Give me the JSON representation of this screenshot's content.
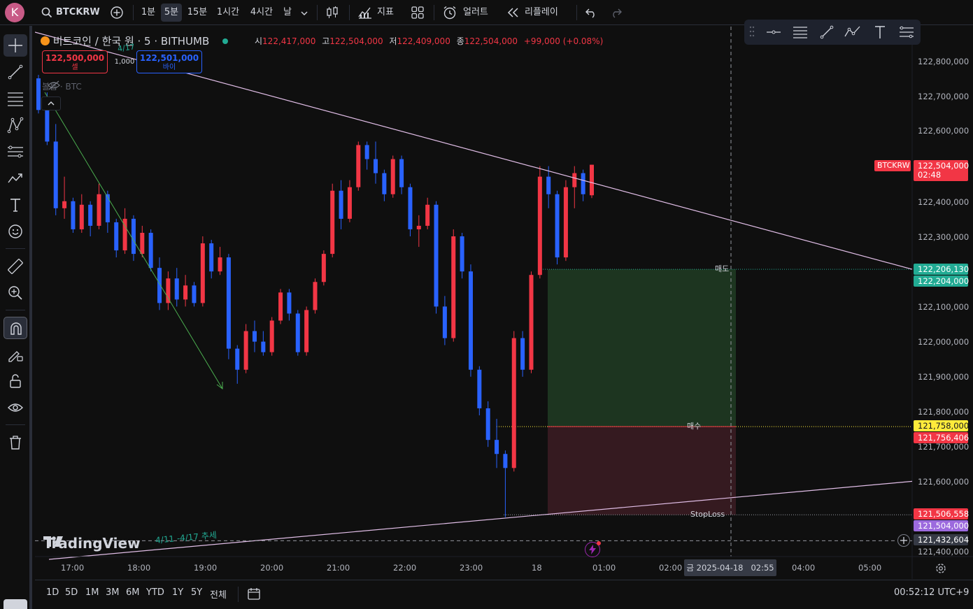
{
  "header": {
    "avatar_letter": "K",
    "symbol": "BTCKRW",
    "intervals": [
      "1분",
      "5분",
      "15분",
      "1시간",
      "4시간",
      "날"
    ],
    "active_interval": "5분",
    "indicators_label": "지표",
    "alert_label": "얼러트",
    "replay_label": "리플레이"
  },
  "legend": {
    "title": "비트코인 / 한국 원 · 5 · BITHUMB",
    "o_label": "시",
    "o_value": "122,417,000",
    "h_label": "고",
    "h_value": "122,504,000",
    "l_label": "저",
    "l_value": "122,409,000",
    "c_label": "종",
    "c_value": "122,504,000",
    "change": "+99,000 (+0.08%)",
    "sell_price": "122,500,000",
    "sell_label": "셀",
    "qty": "1,000",
    "buy_price": "122,501,000",
    "buy_label": "바이",
    "volume_label": "볼륨 · BTC"
  },
  "price_axis": {
    "ticks": [
      "122,800,000",
      "122,700,000",
      "122,600,000",
      "122,400,000",
      "122,300,000",
      "122,100,000",
      "122,000,000",
      "121,900,000",
      "121,800,000",
      "121,700,000",
      "121,600,000",
      "121,400,000"
    ],
    "tags": {
      "symbol": "BTCKRW",
      "last_price": "122,504,000",
      "countdown": "02:48",
      "trend_upper": "122,206,130",
      "target": "122,204,000",
      "entry": "121,758,000",
      "entry_alt": "121,756,406",
      "stop": "121,506,558",
      "trend_lower": "121,504,000",
      "crosshair": "121,432,604"
    }
  },
  "time_axis": {
    "ticks": [
      "17:00",
      "18:00",
      "19:00",
      "20:00",
      "21:00",
      "22:00",
      "23:00",
      "18",
      "01:00",
      "02:00",
      "04:00",
      "05:00"
    ],
    "crosshair_label": "금 2025-04-18   02:55"
  },
  "annotations": {
    "sell_label": "매도",
    "buy_label": "매수",
    "stop_label": "StopLoss",
    "trend_text": "4/11 -4/17 추세",
    "top_trend_text": "4/17",
    "watermark": "TradingView"
  },
  "bottom": {
    "ranges": [
      "1D",
      "5D",
      "1M",
      "3M",
      "6M",
      "YTD",
      "1Y",
      "5Y",
      "전체"
    ],
    "clock": "00:52:12 UTC+9"
  },
  "colors": {
    "up": "#f23645",
    "down": "#2962ff",
    "profit_zone": "#1f3a22",
    "loss_zone": "#3a1c22",
    "target_green": "#22ab94",
    "entry_yellow": "#ffeb3b",
    "trend_line": "#e1bee7",
    "arrow_green": "#4caf50"
  },
  "chart_data": {
    "type": "candlestick",
    "ylim": [
      121350000,
      122850000
    ],
    "candles": [
      [
        122750000,
        122760000,
        122650000,
        122660000
      ],
      [
        122660000,
        122710000,
        122560000,
        122570000
      ],
      [
        122570000,
        122620000,
        122360000,
        122380000
      ],
      [
        122380000,
        122470000,
        122350000,
        122400000
      ],
      [
        122400000,
        122410000,
        122310000,
        122320000
      ],
      [
        122320000,
        122420000,
        122310000,
        122390000
      ],
      [
        122390000,
        122400000,
        122300000,
        122330000
      ],
      [
        122330000,
        122450000,
        122320000,
        122420000
      ],
      [
        122420000,
        122430000,
        122310000,
        122340000
      ],
      [
        122340000,
        122350000,
        122240000,
        122260000
      ],
      [
        122260000,
        122380000,
        122250000,
        122350000
      ],
      [
        122350000,
        122360000,
        122230000,
        122250000
      ],
      [
        122250000,
        122330000,
        122240000,
        122310000
      ],
      [
        122310000,
        122320000,
        122200000,
        122210000
      ],
      [
        122210000,
        122240000,
        122090000,
        122110000
      ],
      [
        122110000,
        122200000,
        122090000,
        122180000
      ],
      [
        122180000,
        122210000,
        122100000,
        122120000
      ],
      [
        122120000,
        122190000,
        122100000,
        122160000
      ],
      [
        122160000,
        122170000,
        122100000,
        122110000
      ],
      [
        122110000,
        122300000,
        122100000,
        122280000
      ],
      [
        122280000,
        122290000,
        122180000,
        122200000
      ],
      [
        122200000,
        122270000,
        122190000,
        122240000
      ],
      [
        122240000,
        122250000,
        121950000,
        121980000
      ],
      [
        121980000,
        121990000,
        121880000,
        121920000
      ],
      [
        121920000,
        122050000,
        121910000,
        122030000
      ],
      [
        122030000,
        122060000,
        121970000,
        122000000
      ],
      [
        122000000,
        122030000,
        121960000,
        121970000
      ],
      [
        121970000,
        122070000,
        121960000,
        122060000
      ],
      [
        122060000,
        122150000,
        122050000,
        122140000
      ],
      [
        122140000,
        122150000,
        122060000,
        122080000
      ],
      [
        122080000,
        122090000,
        121960000,
        121970000
      ],
      [
        121970000,
        122100000,
        121960000,
        122090000
      ],
      [
        122090000,
        122180000,
        122080000,
        122170000
      ],
      [
        122170000,
        122260000,
        122160000,
        122250000
      ],
      [
        122250000,
        122450000,
        122240000,
        122430000
      ],
      [
        122430000,
        122460000,
        122320000,
        122350000
      ],
      [
        122350000,
        122460000,
        122340000,
        122440000
      ],
      [
        122440000,
        122570000,
        122430000,
        122560000
      ],
      [
        122560000,
        122570000,
        122490000,
        122520000
      ],
      [
        122520000,
        122570000,
        122450000,
        122480000
      ],
      [
        122480000,
        122490000,
        122400000,
        122420000
      ],
      [
        122420000,
        122530000,
        122410000,
        122520000
      ],
      [
        122520000,
        122530000,
        122420000,
        122440000
      ],
      [
        122440000,
        122450000,
        122300000,
        122320000
      ],
      [
        122320000,
        122360000,
        122270000,
        122330000
      ],
      [
        122330000,
        122410000,
        122320000,
        122390000
      ],
      [
        122390000,
        122400000,
        122080000,
        122100000
      ],
      [
        122100000,
        122130000,
        121990000,
        122010000
      ],
      [
        122010000,
        122320000,
        122000000,
        122300000
      ],
      [
        122300000,
        122310000,
        122180000,
        122200000
      ],
      [
        122200000,
        122220000,
        121900000,
        121920000
      ],
      [
        121920000,
        121930000,
        121790000,
        121810000
      ],
      [
        121810000,
        121830000,
        121700000,
        121720000
      ],
      [
        121720000,
        121780000,
        121640000,
        121680000
      ],
      [
        121680000,
        121690000,
        121500000,
        121640000
      ],
      [
        121640000,
        122030000,
        121630000,
        122010000
      ],
      [
        122010000,
        122030000,
        121900000,
        121920000
      ],
      [
        121920000,
        122200000,
        121910000,
        122190000
      ],
      [
        122190000,
        122500000,
        122180000,
        122470000
      ],
      [
        122470000,
        122500000,
        122380000,
        122420000
      ],
      [
        122420000,
        122430000,
        122220000,
        122240000
      ],
      [
        122240000,
        122460000,
        122230000,
        122440000
      ],
      [
        122440000,
        122500000,
        122380000,
        122480000
      ],
      [
        122480000,
        122490000,
        122400000,
        122420000
      ],
      [
        122417000,
        122504000,
        122409000,
        122504000
      ]
    ]
  }
}
